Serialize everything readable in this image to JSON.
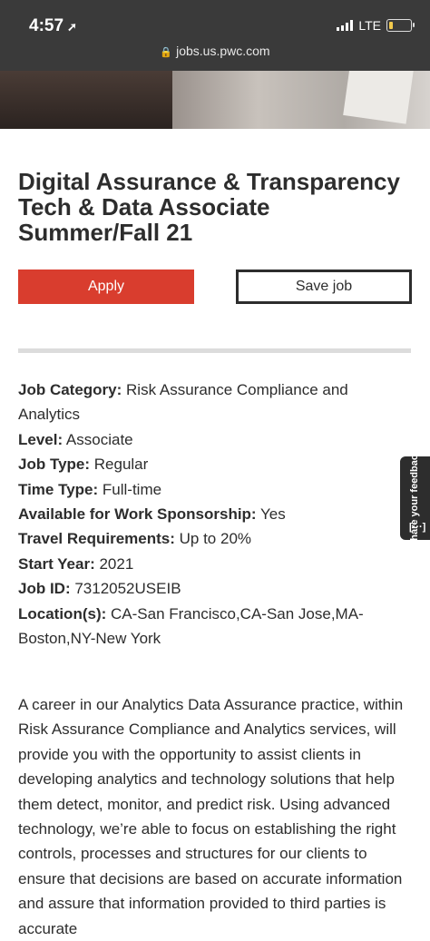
{
  "status_bar": {
    "time": "4:57",
    "network": "LTE"
  },
  "browser": {
    "url": "jobs.us.pwc.com"
  },
  "job": {
    "title": "Digital Assurance & Transparency Tech & Data Associate Summer/Fall 21",
    "apply_label": "Apply",
    "save_label": "Save job",
    "details": [
      {
        "label": "Job Category:",
        "value": " Risk Assurance Compliance and Analytics"
      },
      {
        "label": "Level:",
        "value": " Associate"
      },
      {
        "label": "Job Type:",
        "value": " Regular"
      },
      {
        "label": "Time Type:",
        "value": " Full-time"
      },
      {
        "label": "Available for Work Sponsorship:",
        "value": " Yes"
      },
      {
        "label": "Travel Requirements:",
        "value": " Up to 20%"
      },
      {
        "label": "Start Year:",
        "value": " 2021"
      },
      {
        "label": "Job ID:",
        "value": " 7312052USEIB"
      },
      {
        "label": "Location(s):",
        "value": " CA-San Francisco,CA-San Jose,MA-Boston,NY-New York"
      }
    ],
    "description": "A career in our Analytics Data Assurance practice, within Risk Assurance Compliance and Analytics services, will provide you with the opportunity to assist clients in developing analytics and technology solutions that help them detect, monitor, and predict risk. Using advanced technology, we’re able to focus on establishing the right controls, processes and structures for our clients to ensure that decisions are based on accurate information and assure that information provided to third parties is accurate"
  },
  "feedback": {
    "label": "Share your feedback",
    "icon_text": "[···]"
  }
}
